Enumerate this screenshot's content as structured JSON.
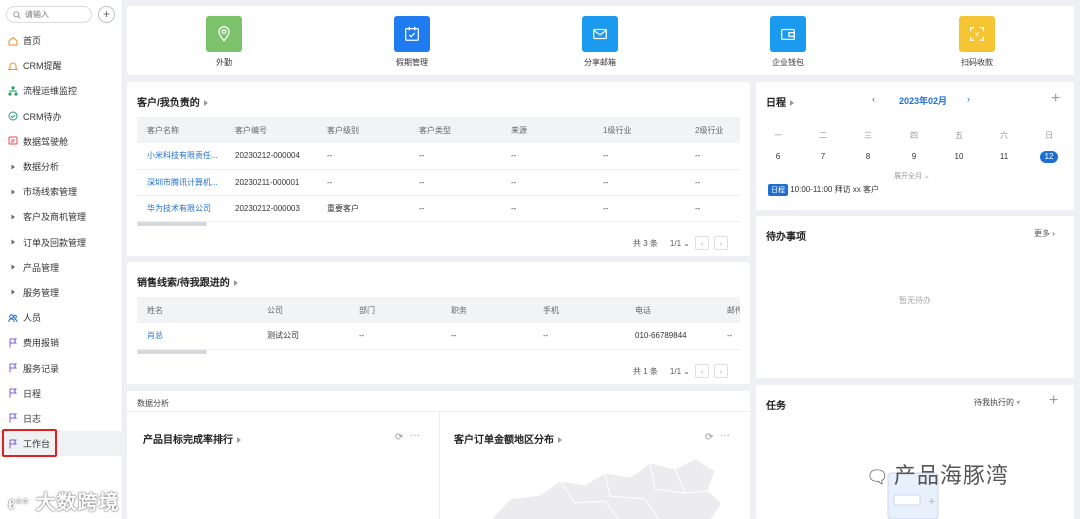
{
  "sidebar": {
    "search_placeholder": "请输入",
    "add_icon": "plus-icon",
    "items": [
      {
        "label": "首页",
        "icon": "home-icon",
        "color": "#f08a24"
      },
      {
        "label": "CRM提醒",
        "icon": "bell-icon",
        "color": "#f08a24"
      },
      {
        "label": "流程运维监控",
        "icon": "org-chart-icon",
        "color": "#22a06b"
      },
      {
        "label": "CRM待办",
        "icon": "check-circle-icon",
        "color": "#22a06b"
      },
      {
        "label": "数据驾驶舱",
        "icon": "dashboard-icon",
        "color": "#e44"
      },
      {
        "label": "数据分析",
        "icon": "caret-right-icon",
        "color": "#666"
      },
      {
        "label": "市场线索管理",
        "icon": "caret-right-icon",
        "color": "#666"
      },
      {
        "label": "客户及商机管理",
        "icon": "caret-right-icon",
        "color": "#666"
      },
      {
        "label": "订单及回款管理",
        "icon": "caret-right-icon",
        "color": "#666"
      },
      {
        "label": "产品管理",
        "icon": "caret-right-icon",
        "color": "#666"
      },
      {
        "label": "服务管理",
        "icon": "caret-right-icon",
        "color": "#666"
      },
      {
        "label": "人员",
        "icon": "people-icon",
        "color": "#1f6fd1"
      },
      {
        "label": "费用报销",
        "icon": "flag-icon",
        "color": "#7b5cd6"
      },
      {
        "label": "服务记录",
        "icon": "flag-icon",
        "color": "#7b5cd6"
      },
      {
        "label": "日程",
        "icon": "flag-icon",
        "color": "#7b5cd6"
      },
      {
        "label": "日志",
        "icon": "flag-icon",
        "color": "#7b5cd6"
      },
      {
        "label": "工作台",
        "icon": "flag-icon",
        "color": "#7b5cd6"
      }
    ]
  },
  "shortcuts": [
    {
      "label": "外勤",
      "icon": "location-pin-icon",
      "color": "#7cc26a"
    },
    {
      "label": "假期管理",
      "icon": "calendar-check-icon",
      "color": "#1f7bf0"
    },
    {
      "label": "分享邮箱",
      "icon": "mail-icon",
      "color": "#1a9bf0"
    },
    {
      "label": "企业钱包",
      "icon": "wallet-icon",
      "color": "#1a9bf0"
    },
    {
      "label": "扫码收款",
      "icon": "scan-icon",
      "color": "#f5c432"
    }
  ],
  "customers": {
    "title": "客户/我负责的",
    "columns": [
      "客户名称",
      "客户编号",
      "客户级别",
      "客户类型",
      "来源",
      "1级行业",
      "2级行业"
    ],
    "rows": [
      [
        "小米科技有限责任...",
        "20230212-000004",
        "--",
        "--",
        "--",
        "--",
        "--"
      ],
      [
        "深圳市腾讯计算机...",
        "20230211-000001",
        "--",
        "--",
        "--",
        "--",
        "--"
      ],
      [
        "华为技术有限公司",
        "20230212-000003",
        "重要客户",
        "--",
        "--",
        "--",
        "--"
      ]
    ],
    "total": "共 3 条",
    "page": "1/1"
  },
  "leads": {
    "title": "销售线索/待我跟进的",
    "columns": [
      "姓名",
      "公司",
      "部门",
      "职务",
      "手机",
      "电话",
      "邮件"
    ],
    "rows": [
      [
        "肖总",
        "测试公司",
        "--",
        "--",
        "--",
        "010-66789844",
        "--"
      ]
    ],
    "total": "共 1 条",
    "page": "1/1"
  },
  "analysis": {
    "header": "数据分析",
    "left_title": "产品目标完成率排行",
    "right_title": "客户订单金额地区分布"
  },
  "calendar": {
    "title": "日程",
    "month": "2023年02月",
    "weekdays": [
      "一",
      "二",
      "三",
      "四",
      "五",
      "六",
      "日"
    ],
    "days": [
      "6",
      "7",
      "8",
      "9",
      "10",
      "11",
      "12"
    ],
    "expand": "展开全月",
    "event_badge": "日程",
    "event_text": "10:00-11:00  拜访 xx 客户"
  },
  "todo": {
    "title": "待办事项",
    "more": "更多",
    "empty": "暂无待办"
  },
  "tasks": {
    "title": "任务",
    "filter": "待我执行的"
  },
  "watermarks": {
    "left": "大数跨境",
    "right": "产品海豚湾"
  }
}
